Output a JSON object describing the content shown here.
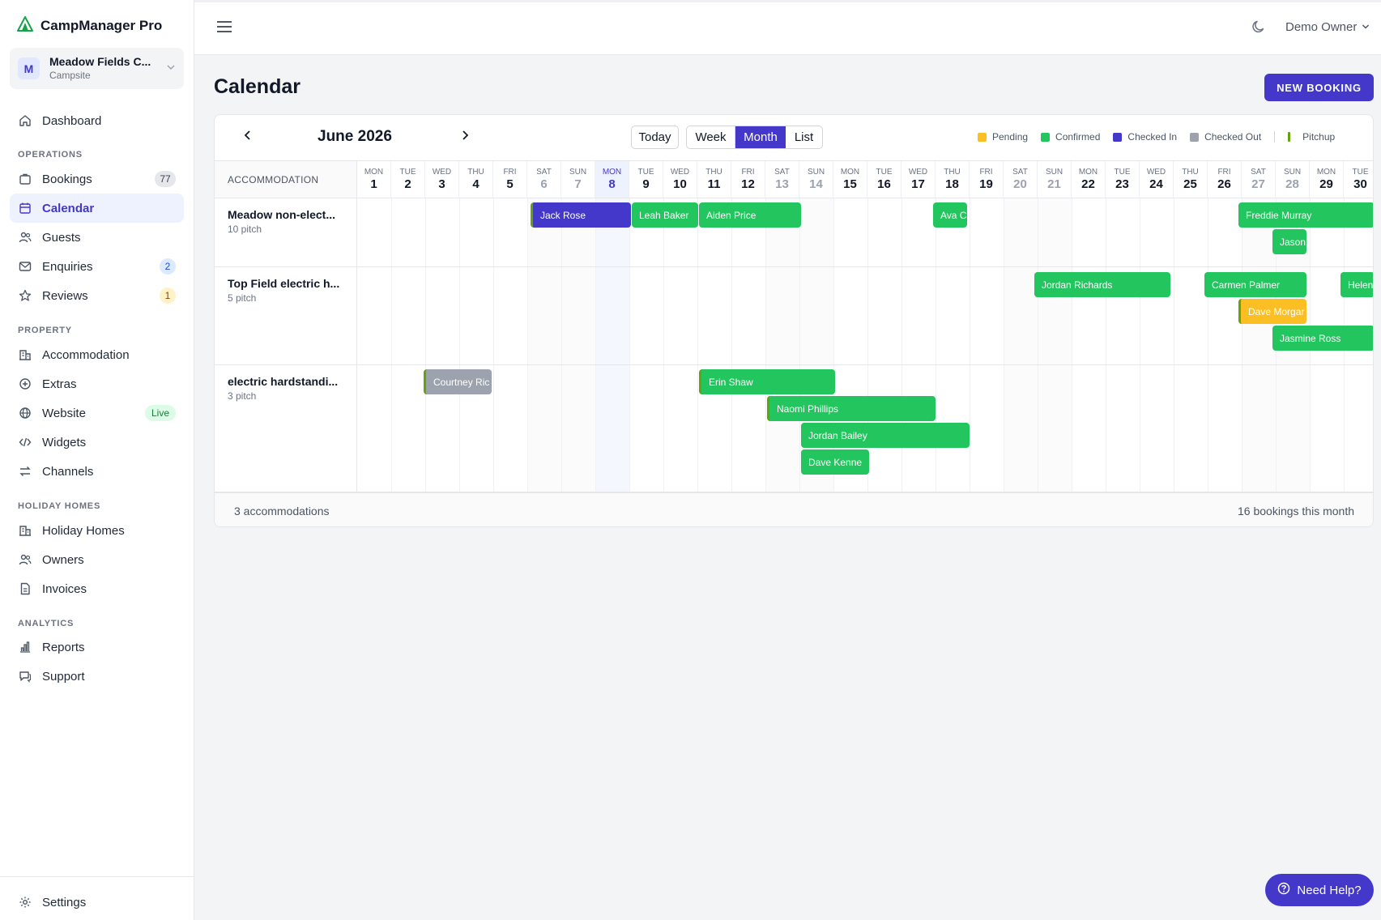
{
  "brand": {
    "name": "CampManager Pro",
    "icon": "tent-icon"
  },
  "site": {
    "initial": "M",
    "name": "Meadow Fields C...",
    "type": "Campsite"
  },
  "nav": {
    "dashboard": "Dashboard",
    "sections": {
      "operations": "OPERATIONS",
      "property": "PROPERTY",
      "holiday_homes": "HOLIDAY HOMES",
      "analytics": "ANALYTICS"
    },
    "bookings": "Bookings",
    "bookings_count": "77",
    "calendar": "Calendar",
    "guests": "Guests",
    "enquiries": "Enquiries",
    "enquiries_count": "2",
    "reviews": "Reviews",
    "reviews_count": "1",
    "accommodation": "Accommodation",
    "extras": "Extras",
    "website": "Website",
    "website_status": "Live",
    "widgets": "Widgets",
    "channels": "Channels",
    "holiday_homes": "Holiday Homes",
    "owners": "Owners",
    "invoices": "Invoices",
    "reports": "Reports",
    "support": "Support",
    "settings": "Settings"
  },
  "topbar": {
    "user": "Demo Owner"
  },
  "page": {
    "title": "Calendar",
    "new_booking": "NEW BOOKING"
  },
  "calendar": {
    "month_label": "June 2026",
    "today": "Today",
    "views": {
      "week": "Week",
      "month": "Month",
      "list": "List"
    },
    "legend": {
      "pending": "Pending",
      "confirmed": "Confirmed",
      "checked_in": "Checked In",
      "checked_out": "Checked Out",
      "pitchup": "Pitchup"
    },
    "colors": {
      "pending": "#fbbf24",
      "confirmed": "#22c55e",
      "checked_in": "#4338ca",
      "checked_out": "#9ca3af",
      "pitchup": "#65a30d"
    },
    "accommodation_header": "ACCOMMODATION",
    "days": [
      {
        "dow": "MON",
        "num": "1"
      },
      {
        "dow": "TUE",
        "num": "2"
      },
      {
        "dow": "WED",
        "num": "3"
      },
      {
        "dow": "THU",
        "num": "4"
      },
      {
        "dow": "FRI",
        "num": "5"
      },
      {
        "dow": "SAT",
        "num": "6"
      },
      {
        "dow": "SUN",
        "num": "7"
      },
      {
        "dow": "MON",
        "num": "8"
      },
      {
        "dow": "TUE",
        "num": "9"
      },
      {
        "dow": "WED",
        "num": "10"
      },
      {
        "dow": "THU",
        "num": "11"
      },
      {
        "dow": "FRI",
        "num": "12"
      },
      {
        "dow": "SAT",
        "num": "13"
      },
      {
        "dow": "SUN",
        "num": "14"
      },
      {
        "dow": "MON",
        "num": "15"
      },
      {
        "dow": "TUE",
        "num": "16"
      },
      {
        "dow": "WED",
        "num": "17"
      },
      {
        "dow": "THU",
        "num": "18"
      },
      {
        "dow": "FRI",
        "num": "19"
      },
      {
        "dow": "SAT",
        "num": "20"
      },
      {
        "dow": "SUN",
        "num": "21"
      },
      {
        "dow": "MON",
        "num": "22"
      },
      {
        "dow": "TUE",
        "num": "23"
      },
      {
        "dow": "WED",
        "num": "24"
      },
      {
        "dow": "THU",
        "num": "25"
      },
      {
        "dow": "FRI",
        "num": "26"
      },
      {
        "dow": "SAT",
        "num": "27"
      },
      {
        "dow": "SUN",
        "num": "28"
      },
      {
        "dow": "MON",
        "num": "29"
      },
      {
        "dow": "TUE",
        "num": "30"
      }
    ],
    "accommodations": [
      {
        "name": "Meadow non-elect...",
        "sub": "10 pitch"
      },
      {
        "name": "Top Field electric h...",
        "sub": "5 pitch"
      },
      {
        "name": "electric hardstandi...",
        "sub": "3 pitch"
      }
    ],
    "bookings": [
      {
        "label": "Jack Rose",
        "status": "checkedin",
        "pitchup": true
      },
      {
        "label": "Leah Baker",
        "status": "confirmed"
      },
      {
        "label": "Aiden Price",
        "status": "confirmed"
      },
      {
        "label": "Ava C",
        "status": "confirmed"
      },
      {
        "label": "Freddie Murray",
        "status": "confirmed"
      },
      {
        "label": "Jason",
        "status": "confirmed"
      },
      {
        "label": "Jordan Richards",
        "status": "confirmed"
      },
      {
        "label": "Carmen Palmer",
        "status": "confirmed"
      },
      {
        "label": "Helen",
        "status": "confirmed"
      },
      {
        "label": "Dave Morgar",
        "status": "pending",
        "pitchup": true
      },
      {
        "label": "Jasmine Ross",
        "status": "confirmed"
      },
      {
        "label": "Courtney Ric",
        "status": "checkedout",
        "pitchup": true
      },
      {
        "label": "Erin Shaw",
        "status": "confirmed",
        "pitchup": true
      },
      {
        "label": "Naomi Phillips",
        "status": "confirmed",
        "pitchup": true
      },
      {
        "label": "Jordan Bailey",
        "status": "confirmed"
      },
      {
        "label": "Dave Kenne",
        "status": "confirmed"
      }
    ],
    "footer_left": "3 accommodations",
    "footer_right": "16 bookings this month"
  },
  "help": {
    "label": "Need Help?"
  }
}
